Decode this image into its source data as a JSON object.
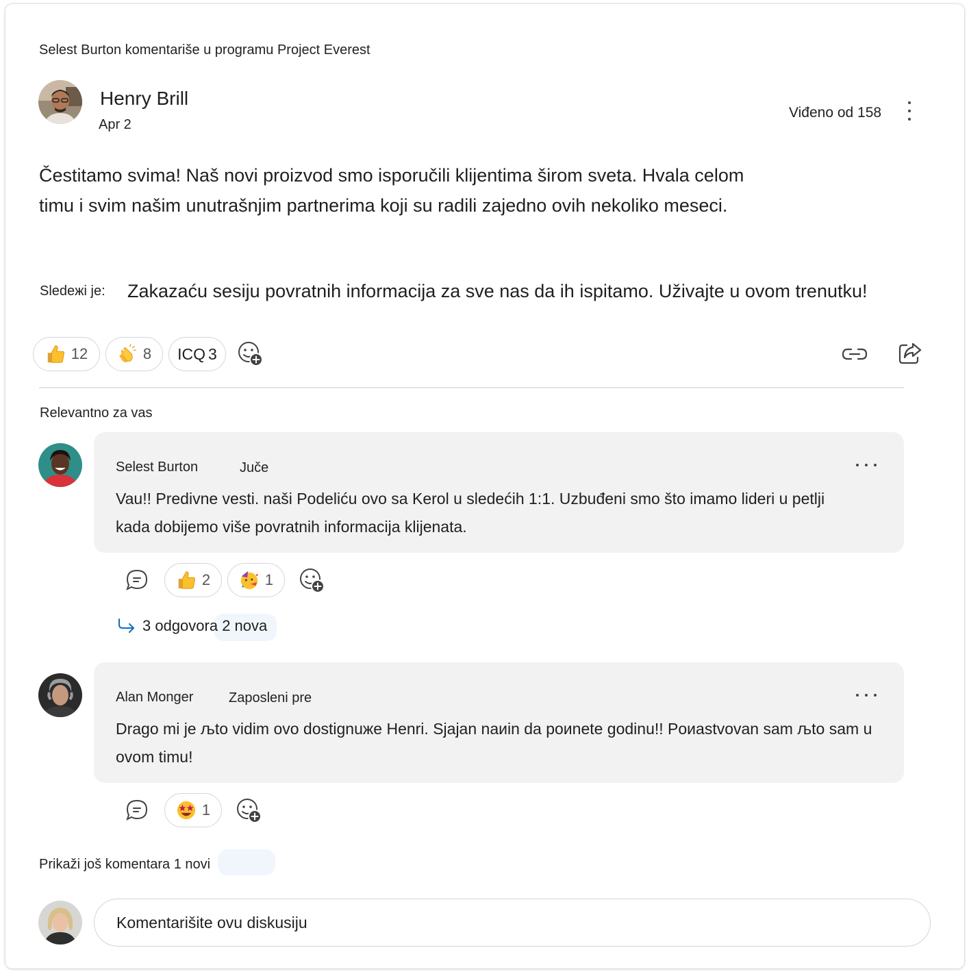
{
  "post": {
    "context": "Selest Burton komentariše u programu Project Everest",
    "author": "Henry Brill",
    "date": "Apr 2",
    "seen": "Viđeno od 158",
    "body": "Čestitamo svima! Naš novi proizvod smo isporučili klijentima širom sveta. Hvala celom timu i svim našim unutrašnjim partnerima koji su radili zajedno ovih nekoliko meseci.",
    "following_label": "Sledeжi je:",
    "body2": "Zakazaću sesiju povratnih informacija za sve nas da ih ispitamo. Uživajte u ovom trenutku!",
    "reactions": [
      {
        "icon": "thumbs-up-emoji",
        "count": "12"
      },
      {
        "icon": "clapping-hands-emoji",
        "count": "8"
      },
      {
        "icon": "icq-text",
        "label": "ICQ",
        "count": "3"
      }
    ]
  },
  "relevant_label": "Relevantno za vas",
  "comments": [
    {
      "name": "Selest Burton",
      "time": "Juče",
      "text": "Vau!! Predivne vesti. naši     Podeliću ovo sa Kerol u sledećih 1:1. Uzbuđeni smo što imamo lideri u petlji kada dobijemo više povratnih informacija klijenata.",
      "reactions": [
        {
          "icon": "thumbs-up-emoji",
          "count": "2"
        },
        {
          "icon": "party-face-emoji",
          "count": "1"
        }
      ],
      "replies": "3 odgovora 2 nova"
    },
    {
      "name": "Alan Monger",
      "time": "Zaposleni pre",
      "text": "Drago mi je љto vidim ovo dostignuжe Henri. Sjajan naиin da poиnete godinu!! Poиastvovan sam љto sam u ovom timu!",
      "reactions": [
        {
          "icon": "star-struck-emoji",
          "count": "1"
        }
      ]
    }
  ],
  "more_comments": "Prikaži još komentara 1 novi",
  "comment_placeholder": "Komentarišite ovu diskusiju",
  "colors": {
    "accent": "#0f6cbd",
    "bubble": "#f2f2f2",
    "badge_bg": "#f1f6fd"
  }
}
